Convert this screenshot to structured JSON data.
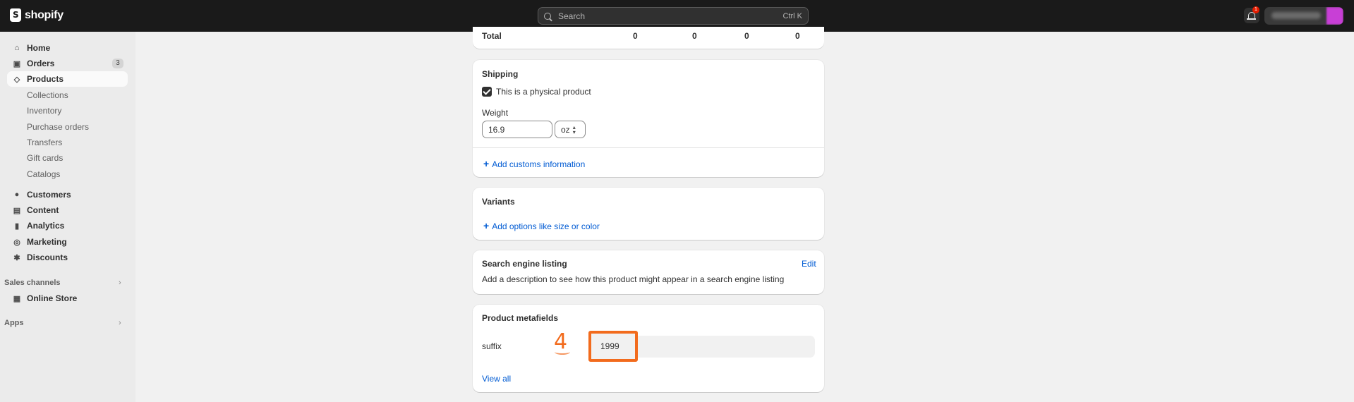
{
  "topbar": {
    "brand": "shopify",
    "search_placeholder": "Search",
    "search_shortcut": "Ctrl K",
    "notification_count": "1"
  },
  "sidebar": {
    "items": [
      {
        "label": "Home",
        "icon": "home-icon"
      },
      {
        "label": "Orders",
        "icon": "inbox-icon",
        "badge": "3"
      },
      {
        "label": "Products",
        "icon": "tag-icon",
        "active": true
      },
      {
        "label": "Customers",
        "icon": "person-icon"
      },
      {
        "label": "Content",
        "icon": "content-icon"
      },
      {
        "label": "Analytics",
        "icon": "bar-chart-icon"
      },
      {
        "label": "Marketing",
        "icon": "target-icon"
      },
      {
        "label": "Discounts",
        "icon": "discount-icon"
      }
    ],
    "product_subitems": [
      "Collections",
      "Inventory",
      "Purchase orders",
      "Transfers",
      "Gift cards",
      "Catalogs"
    ],
    "sales_channels_label": "Sales channels",
    "online_store_label": "Online Store",
    "apps_label": "Apps"
  },
  "main": {
    "total": {
      "label": "Total",
      "values": [
        "0",
        "0",
        "0",
        "0"
      ]
    },
    "shipping": {
      "title": "Shipping",
      "physical_product_label": "This is a physical product",
      "physical_product_checked": true,
      "weight_label": "Weight",
      "weight_value": "16.9",
      "weight_unit": "oz",
      "customs_link": "Add customs information"
    },
    "variants": {
      "title": "Variants",
      "add_options_link": "Add options like size or color"
    },
    "seo": {
      "title": "Search engine listing",
      "edit_label": "Edit",
      "description": "Add a description to see how this product might appear in a search engine listing"
    },
    "metafields": {
      "title": "Product metafields",
      "fields": [
        {
          "label": "suffix",
          "value": "1999"
        }
      ],
      "view_all_label": "View all"
    },
    "annotation": {
      "step_number": "4",
      "color": "#f26b1d"
    }
  }
}
